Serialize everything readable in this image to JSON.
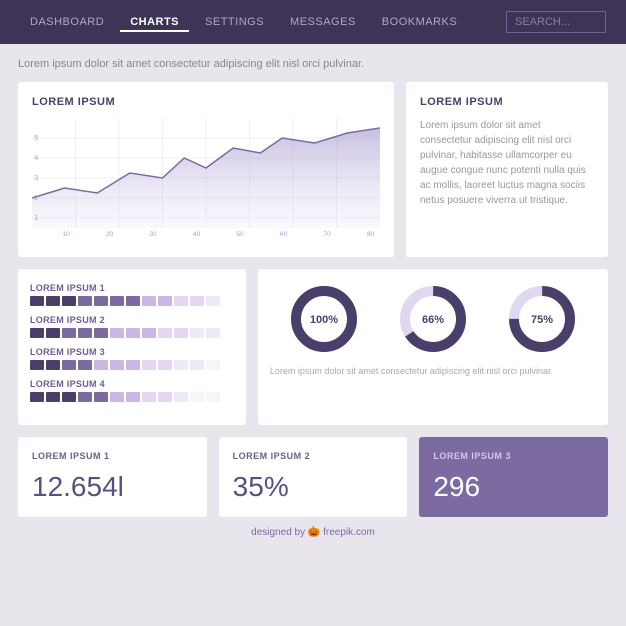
{
  "nav": {
    "items": [
      {
        "label": "DASHBOARD",
        "active": false
      },
      {
        "label": "CHARTS",
        "active": true
      },
      {
        "label": "SETTINGS",
        "active": false
      },
      {
        "label": "MESSAGES",
        "active": false
      },
      {
        "label": "BOOKMARKS",
        "active": false
      }
    ],
    "search_placeholder": "SEARCH..."
  },
  "page": {
    "subtitle": "Lorem ipsum dolor sit amet consectetur adipiscing elit nisl orci pulvinar."
  },
  "area_chart": {
    "title": "LOREM IPSUM"
  },
  "text_card": {
    "title": "LOREM IPSUM",
    "body": "Lorem ipsum dolor sit amet consectetur adipiscing elit nisl orci pulvinar, habitasse ullamcorper eu augue congue nunc potenti nulla quis ac mollis, laoreet luctus magna sociis netus posuere viverra ut tristique."
  },
  "bar_section": {
    "rows": [
      {
        "label": "LOREM IPSUM 1",
        "filled": 7,
        "light": 5
      },
      {
        "label": "LOREM IPSUM 2",
        "filled": 5,
        "light": 7
      },
      {
        "label": "LOREM IPSUM 3",
        "filled": 4,
        "light": 8
      },
      {
        "label": "LOREM IPSUM 4",
        "filled": 3,
        "light": 9
      }
    ]
  },
  "donuts": {
    "items": [
      {
        "label": "100%",
        "value": 100
      },
      {
        "label": "66%",
        "value": 66
      },
      {
        "label": "75%",
        "value": 75
      }
    ],
    "text": "Lorem ipsum dolor sit amet consectetur adipiscing elit nisl orci pulvinar."
  },
  "stats": [
    {
      "label": "LOREM IPSUM 1",
      "value": "12.654l",
      "accent": false
    },
    {
      "label": "LOREM IPSUM 2",
      "value": "35%",
      "accent": false
    },
    {
      "label": "LOREM IPSUM 3",
      "value": "296",
      "accent": true
    }
  ],
  "footer": {
    "text": "designed by",
    "brand": "🎃 freepik.com"
  },
  "colors": {
    "dark_purple": "#3d3456",
    "mid_purple": "#7c6ba0",
    "light_purple": "#b8a8d0",
    "lighter_purple": "#ddd0ee",
    "block_dark": "#5a4f80",
    "block_light": "#c8b8e0"
  }
}
